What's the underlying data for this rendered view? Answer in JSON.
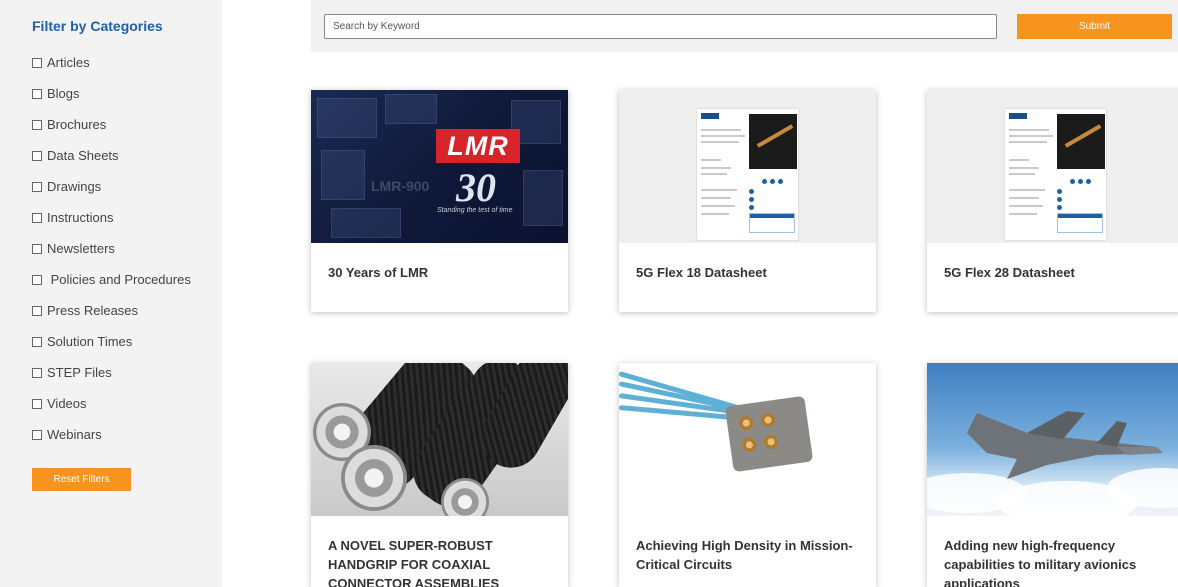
{
  "sidebar": {
    "title": "Filter by Categories",
    "filters": [
      "Articles",
      "Blogs",
      "Brochures",
      "Data Sheets",
      "Drawings",
      "Instructions",
      "Newsletters",
      "Policies and Procedures",
      "Press Releases",
      "Solution Times",
      "STEP Files",
      "Videos",
      "Webinars"
    ],
    "reset_label": "Reset Filters"
  },
  "search": {
    "placeholder": "Search by Keyword",
    "value": "",
    "submit_label": "Submit"
  },
  "cards": [
    {
      "title": "30 Years of LMR",
      "image": "lmr-30-years-graphic",
      "image_text": {
        "logo": "LMR",
        "number": "30",
        "tagline": "Standing the test of time",
        "ghost": "LMR-900"
      }
    },
    {
      "title": "5G Flex 18 Datasheet",
      "image": "datasheet-thumbnail"
    },
    {
      "title": "5G Flex 28 Datasheet",
      "image": "datasheet-thumbnail"
    },
    {
      "title": "A NOVEL SUPER-ROBUST HANDGRIP FOR COAXIAL CONNECTOR ASSEMBLIES",
      "image": "coaxial-connectors-photo"
    },
    {
      "title": "Achieving High Density in Mission-Critical Circuits",
      "image": "cable-connector-photo"
    },
    {
      "title": "Adding new high-frequency capabilities to military avionics applications",
      "image": "fighter-jet-photo"
    }
  ],
  "colors": {
    "accent": "#f7941d",
    "sidebar_title": "#1f5fa6",
    "sidebar_bg": "#f3f3f3"
  }
}
